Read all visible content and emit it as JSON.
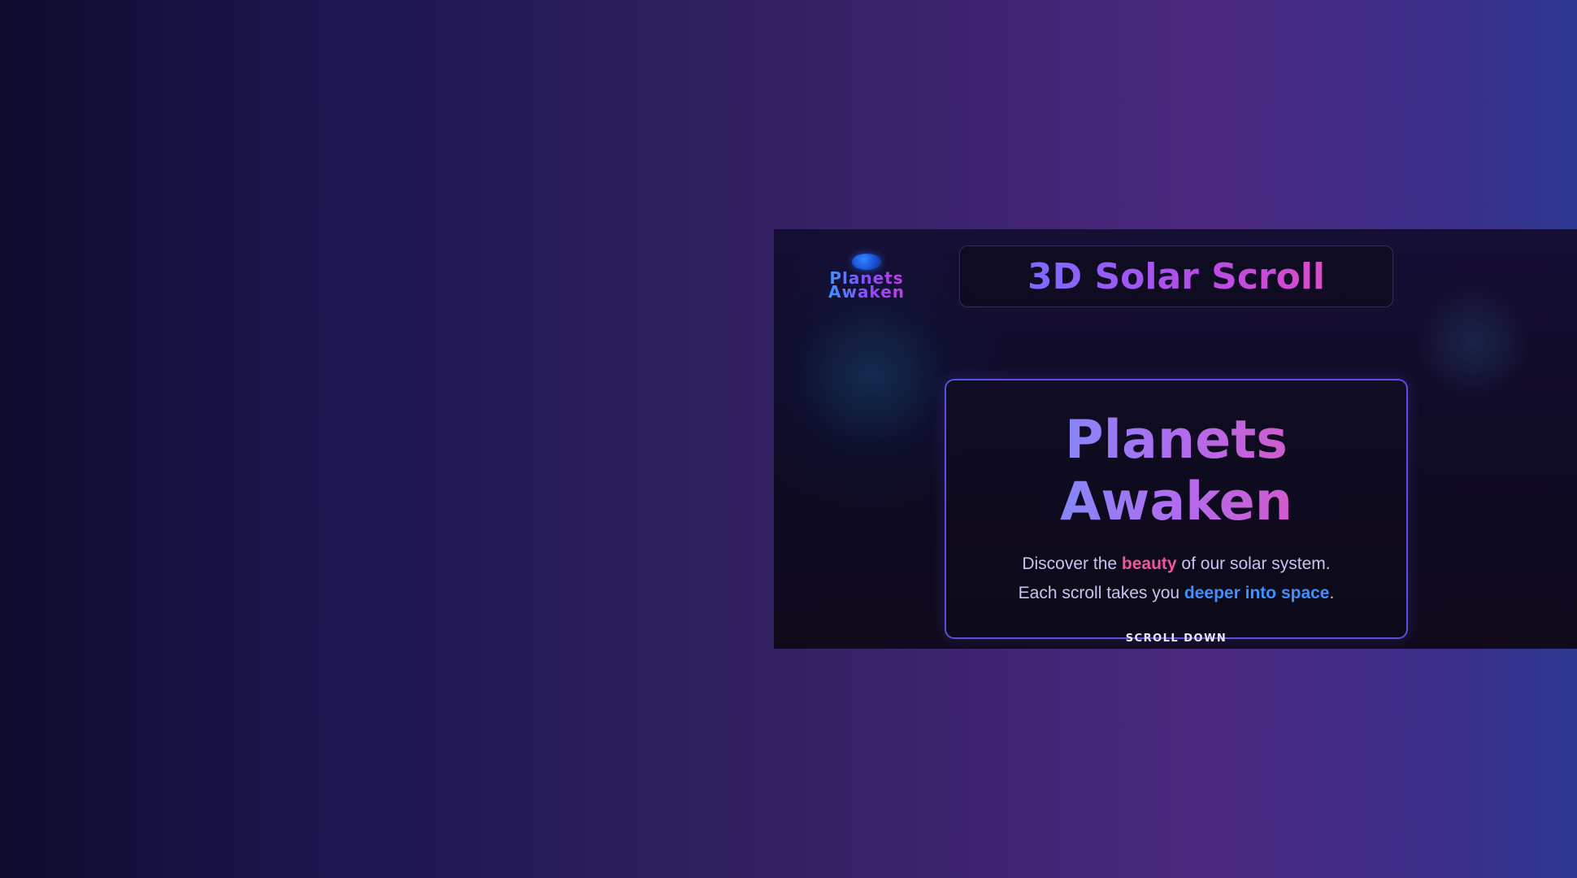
{
  "app": {
    "logo": {
      "line1": "Planets",
      "line2": "Awaken"
    },
    "title": "3D Solar Scroll",
    "hero": {
      "heading": "Planets Awaken",
      "line1": {
        "before": "Discover the ",
        "highlight": "beauty",
        "after": " of our solar system."
      },
      "line2": {
        "before": "Each scroll takes you ",
        "highlight": "deeper into space",
        "after": "."
      },
      "scroll_label": "SCROLL DOWN"
    }
  },
  "colors": {
    "accent_pink": "#f0559f",
    "accent_blue": "#3f8fff",
    "card_border": "#5a4fe0"
  },
  "icons": {
    "planet": "planet-logo-icon",
    "chevron": "chevron-down-icon"
  }
}
